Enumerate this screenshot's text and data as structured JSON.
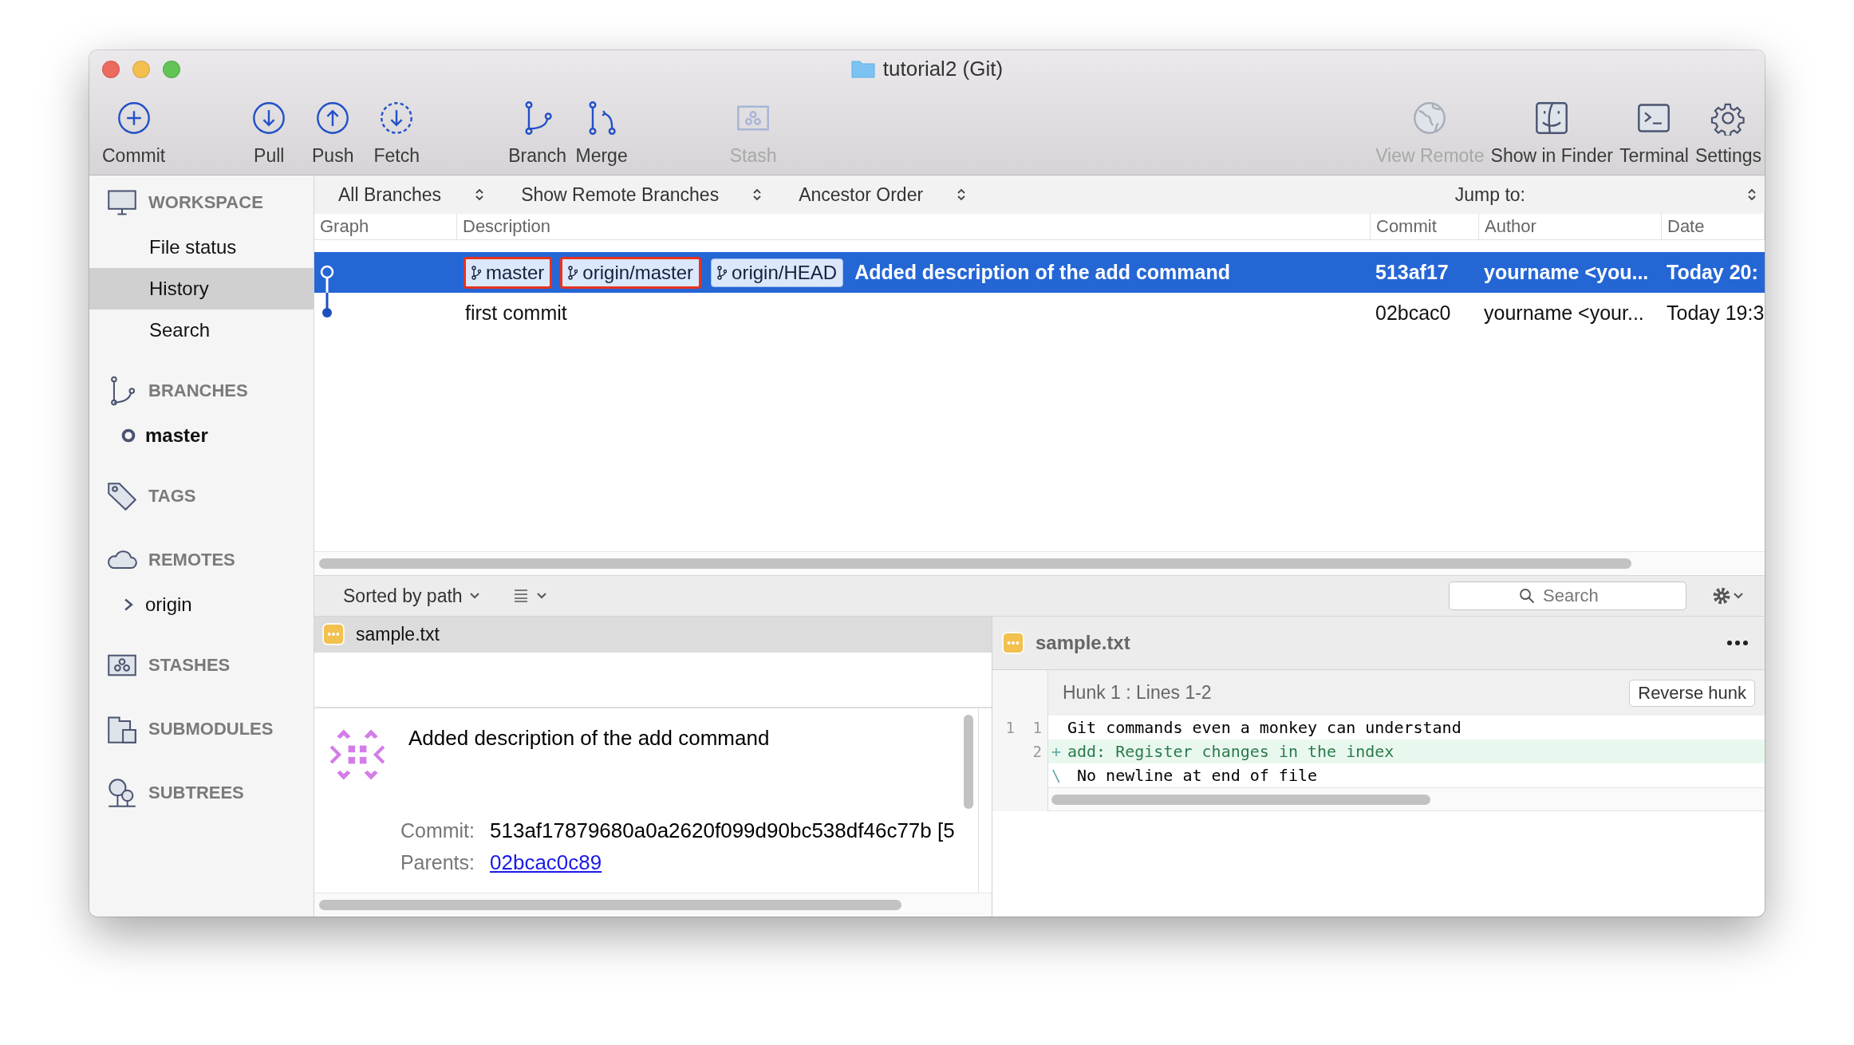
{
  "window": {
    "title": "tutorial2 (Git)"
  },
  "toolbar": {
    "groups": [
      [
        {
          "label": "Commit",
          "disabled": false
        }
      ],
      [
        {
          "label": "Pull",
          "disabled": false
        },
        {
          "label": "Push",
          "disabled": false
        },
        {
          "label": "Fetch",
          "disabled": false
        }
      ],
      [
        {
          "label": "Branch",
          "disabled": false
        },
        {
          "label": "Merge",
          "disabled": false
        }
      ],
      [
        {
          "label": "Stash",
          "disabled": true
        }
      ]
    ],
    "right": [
      {
        "label": "View Remote",
        "disabled": true
      },
      {
        "label": "Show in Finder",
        "disabled": false
      },
      {
        "label": "Terminal",
        "disabled": false
      },
      {
        "label": "Settings",
        "disabled": false
      }
    ]
  },
  "sidebar": {
    "sections": [
      {
        "title": "WORKSPACE",
        "items": [
          {
            "label": "File status",
            "kind": "view",
            "selected": false
          },
          {
            "label": "History",
            "kind": "view",
            "selected": true
          },
          {
            "label": "Search",
            "kind": "view",
            "selected": false
          }
        ]
      },
      {
        "title": "BRANCHES",
        "items": [
          {
            "label": "master",
            "kind": "branch",
            "selected": false
          }
        ]
      },
      {
        "title": "TAGS"
      },
      {
        "title": "REMOTES",
        "items": [
          {
            "label": "origin",
            "kind": "remote",
            "selected": false
          }
        ]
      },
      {
        "title": "STASHES"
      },
      {
        "title": "SUBMODULES"
      },
      {
        "title": "SUBTREES"
      }
    ]
  },
  "filters": [
    {
      "label": "All Branches"
    },
    {
      "label": "Show Remote Branches"
    },
    {
      "label": "Ancestor Order"
    }
  ],
  "jump_to": {
    "label": "Jump to:"
  },
  "table": {
    "columns": [
      "Graph",
      "Description",
      "Commit",
      "Author",
      "Date"
    ],
    "rows": [
      {
        "selected": true,
        "tags": [
          {
            "label": "master",
            "highlighted": true
          },
          {
            "label": "origin/master",
            "highlighted": true
          },
          {
            "label": "origin/HEAD",
            "highlighted": false
          }
        ],
        "description": "Added description of the add command",
        "commit": "513af17",
        "author": "yourname <you...",
        "date": "Today 20:"
      },
      {
        "selected": false,
        "tags": [],
        "description": "first commit",
        "commit": "02bcac0",
        "author": "yourname <your...",
        "date": "Today 19:3"
      }
    ]
  },
  "lower_toolbar": {
    "sort": "Sorted by path",
    "search": {
      "placeholder": "Search"
    }
  },
  "files": [
    {
      "name": "sample.txt",
      "selected": true
    }
  ],
  "commit_details": {
    "message": "Added description of the add command",
    "fields": [
      {
        "label": "Commit:",
        "value": "513af17879680a0a2620f099d90bc538df46c77b [5",
        "kind": "text"
      },
      {
        "label": "Parents:",
        "value": "02bcac0c89",
        "kind": "link"
      }
    ]
  },
  "diff": {
    "file": "sample.txt",
    "hunk": {
      "title": "Hunk 1 : Lines 1-2",
      "button": "Reverse hunk"
    },
    "lines": [
      {
        "old": "1",
        "new": "1",
        "text": "Git commands even a monkey can understand",
        "kind": "context"
      },
      {
        "new": "2",
        "marker": "+",
        "text": "add: Register changes in the index",
        "kind": "added"
      },
      {
        "marker": "\\",
        "text": "No newline at end of file",
        "kind": "note"
      }
    ]
  }
}
